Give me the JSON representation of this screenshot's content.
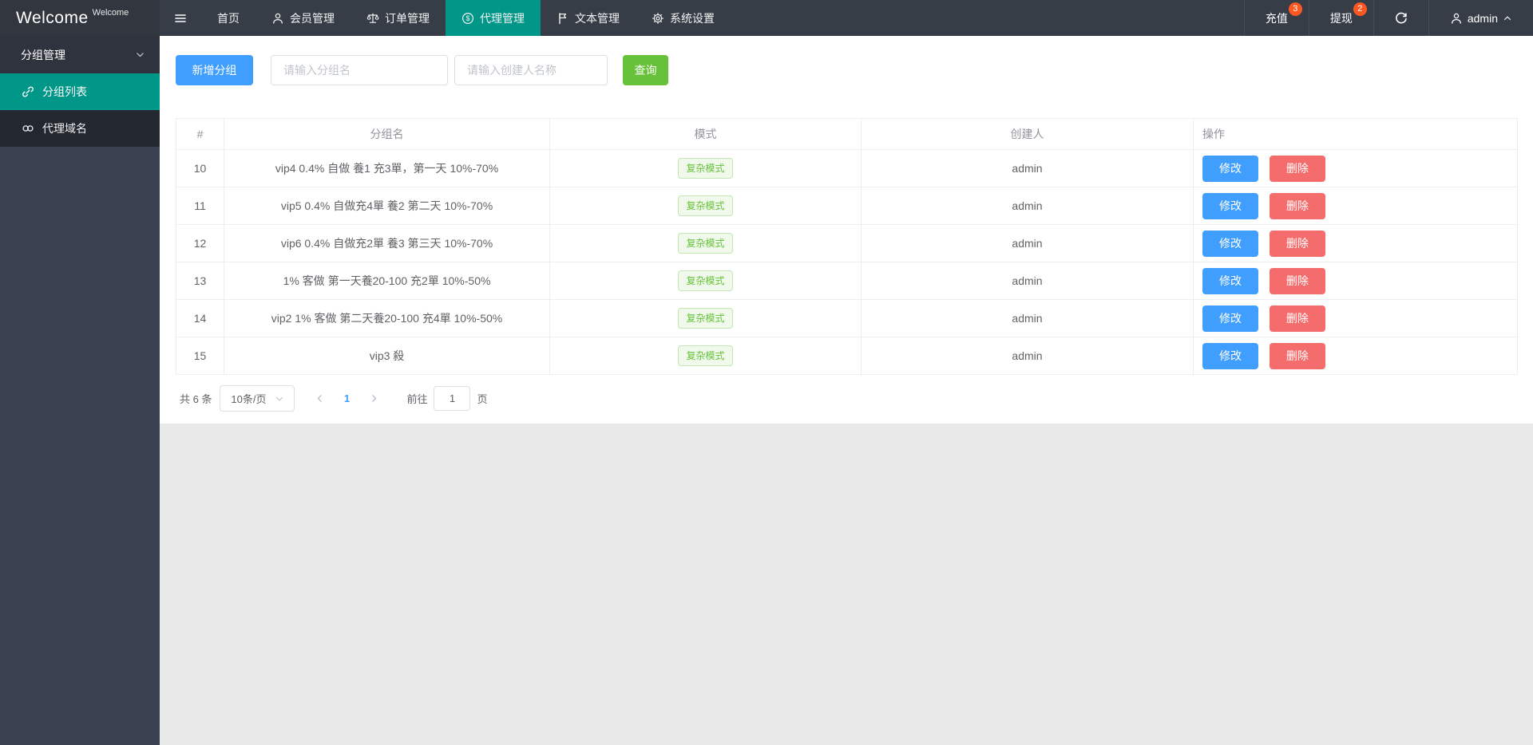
{
  "navbar": {
    "logo_main": "Welcome",
    "logo_sup": "Welcome",
    "menu": [
      {
        "name": "home",
        "label": "首页",
        "icon": null,
        "active": false
      },
      {
        "name": "members",
        "label": "会员管理",
        "icon": "person-icon",
        "active": false
      },
      {
        "name": "orders",
        "label": "订单管理",
        "icon": "scale-icon",
        "active": false
      },
      {
        "name": "agents",
        "label": "代理管理",
        "icon": "dollar-circle-icon",
        "active": true
      },
      {
        "name": "texts",
        "label": "文本管理",
        "icon": "flag-icon",
        "active": false
      },
      {
        "name": "settings",
        "label": "系统设置",
        "icon": "gear-icon",
        "active": false
      }
    ],
    "right_items": [
      {
        "name": "recharge",
        "label": "充值",
        "badge": "3"
      },
      {
        "name": "withdraw",
        "label": "提现",
        "badge": "2"
      }
    ],
    "user": "admin"
  },
  "sidebar": {
    "group_header": "分组管理",
    "items": [
      {
        "name": "group-list",
        "label": "分组列表",
        "icon": "link-icon",
        "active": true
      },
      {
        "name": "agent-domain",
        "label": "代理域名",
        "icon": "unlink-icon",
        "active": false
      }
    ]
  },
  "toolbar": {
    "add_button": "新增分组",
    "group_placeholder": "请输入分组名",
    "creator_placeholder": "请输入创建人名称",
    "search_button": "查询"
  },
  "table": {
    "headers": {
      "id": "#",
      "name": "分组名",
      "mode": "模式",
      "creator": "创建人",
      "ops": "操作"
    },
    "edit_label": "修改",
    "delete_label": "删除",
    "rows": [
      {
        "id": "10",
        "name": "vip4 0.4% 自做 養1 充3單，第一天 10%-70%",
        "mode": "复杂模式",
        "creator": "admin"
      },
      {
        "id": "11",
        "name": "vip5 0.4% 自做充4單 養2 第二天 10%-70%",
        "mode": "复杂模式",
        "creator": "admin"
      },
      {
        "id": "12",
        "name": "vip6 0.4% 自做充2單 養3 第三天 10%-70%",
        "mode": "复杂模式",
        "creator": "admin"
      },
      {
        "id": "13",
        "name": "1% 客做 第一天養20-100 充2單 10%-50%",
        "mode": "复杂模式",
        "creator": "admin"
      },
      {
        "id": "14",
        "name": "vip2 1% 客做 第二天養20-100 充4單 10%-50%",
        "mode": "复杂模式",
        "creator": "admin"
      },
      {
        "id": "15",
        "name": "vip3 殺",
        "mode": "复杂模式",
        "creator": "admin"
      }
    ]
  },
  "pagination": {
    "total": "共 6 条",
    "page_size": "10条/页",
    "current_page": "1",
    "goto_label": "前往",
    "goto_value": "1",
    "page_label": "页"
  },
  "colors": {
    "accent_teal": "#009688",
    "primary_blue": "#409eff",
    "danger_red": "#f56c6c",
    "success_green": "#67c23a",
    "badge_orange": "#ff5722",
    "navbar_bg": "#373d47",
    "sidebar_bg": "#3a4150"
  }
}
